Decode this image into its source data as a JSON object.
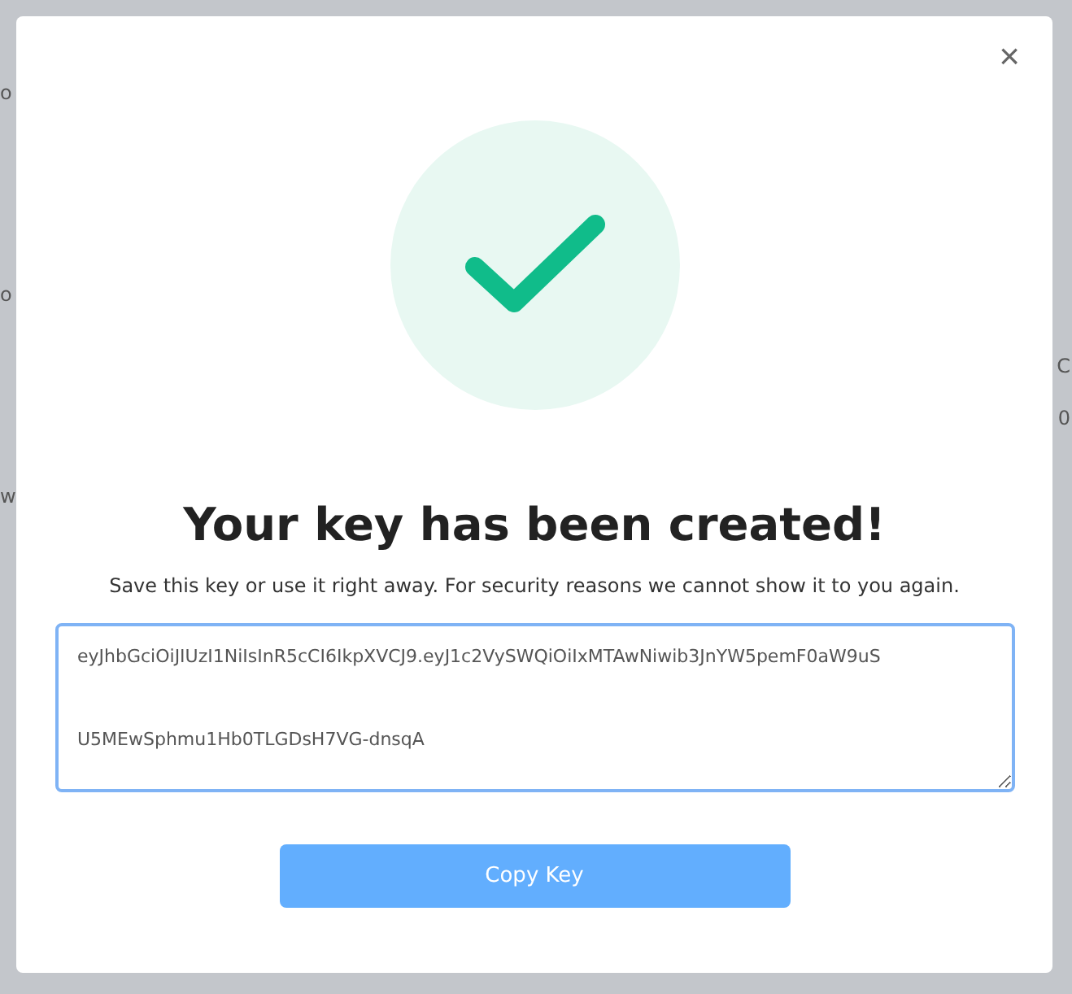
{
  "background": {
    "left_fragments": [
      "o",
      "o",
      "w"
    ],
    "right_fragments": [
      "C",
      "0"
    ]
  },
  "modal": {
    "close": "×",
    "title": "Your key has been created!",
    "message": "Save this key or use it right away. For security reasons we cannot show it to you again.",
    "key_lines": [
      "eyJhbGciOiJIUzI1NiIsInR5cCI6IkpXVCJ9.eyJ1c2VySWQiOiIxMTAwNiwib3JnYW5pemF0aW9uS",
      "U5MEwSphmu1Hb0TLGDsH7VG-dnsqA"
    ],
    "button": "Copy Key"
  }
}
